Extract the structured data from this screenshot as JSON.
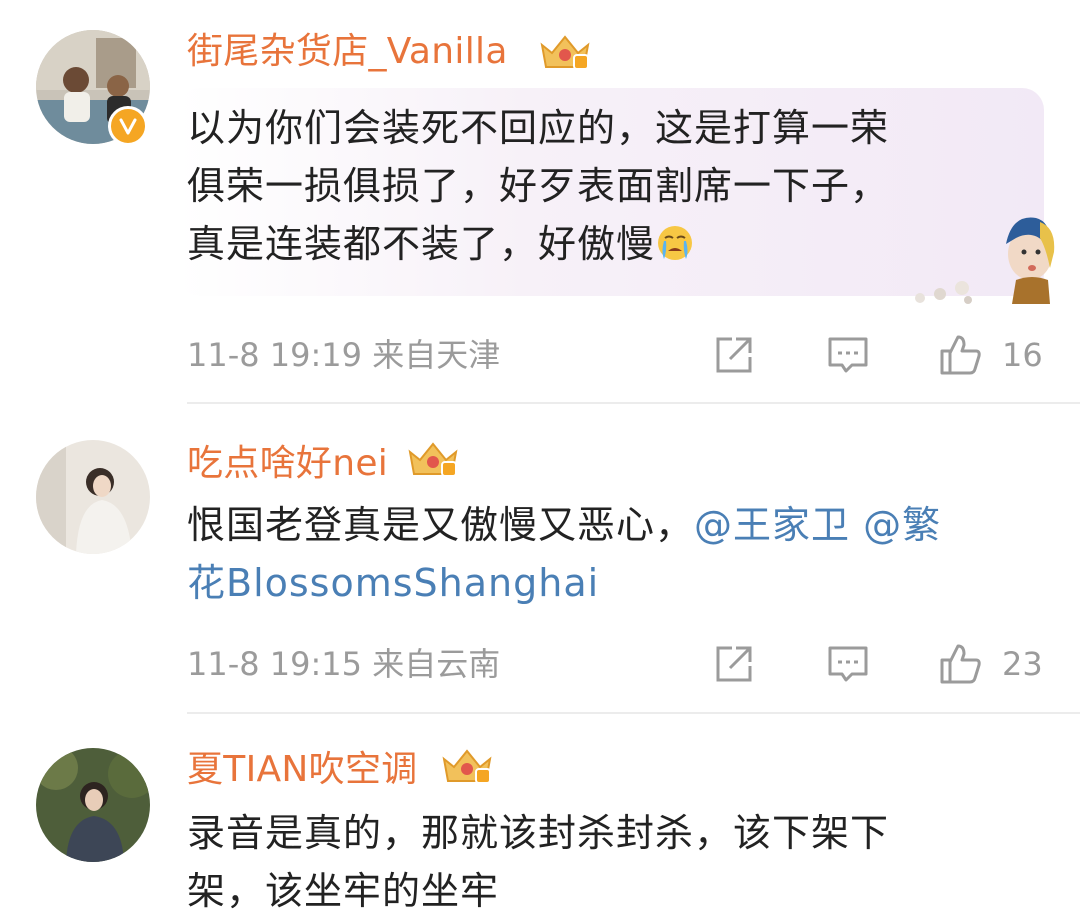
{
  "comments": [
    {
      "username": "街尾杂货店_Vanilla",
      "content_lines": [
        "以为你们会装死不回应的，这是打算一荣",
        "俱荣一损俱损了，好歹表面割席一下子，",
        "真是连装都不装了，好傲慢"
      ],
      "emoji": "crying-emoji",
      "timestamp": "11-8 19:19",
      "location": "来自天津",
      "likes": "16",
      "verified": true
    },
    {
      "username": "吃点啥好nei",
      "content_text": "恨国老登真是又傲慢又恶心，",
      "mentions": [
        "@王家卫",
        "@繁",
        "花BlossomsShanghai"
      ],
      "timestamp": "11-8 19:15",
      "location": "来自云南",
      "likes": "23"
    },
    {
      "username": "夏TIAN吹空调",
      "content_lines": [
        "录音是真的，那就该封杀封杀，该下架下",
        "架，该坐牢的坐牢"
      ]
    }
  ],
  "colors": {
    "username": "#e8743b",
    "mention": "#4a7fb5",
    "meta": "#9b9b9b",
    "text": "#222222"
  },
  "icons": [
    "share-icon",
    "comment-icon",
    "like-icon",
    "crown-badge-icon",
    "verified-badge-icon"
  ]
}
